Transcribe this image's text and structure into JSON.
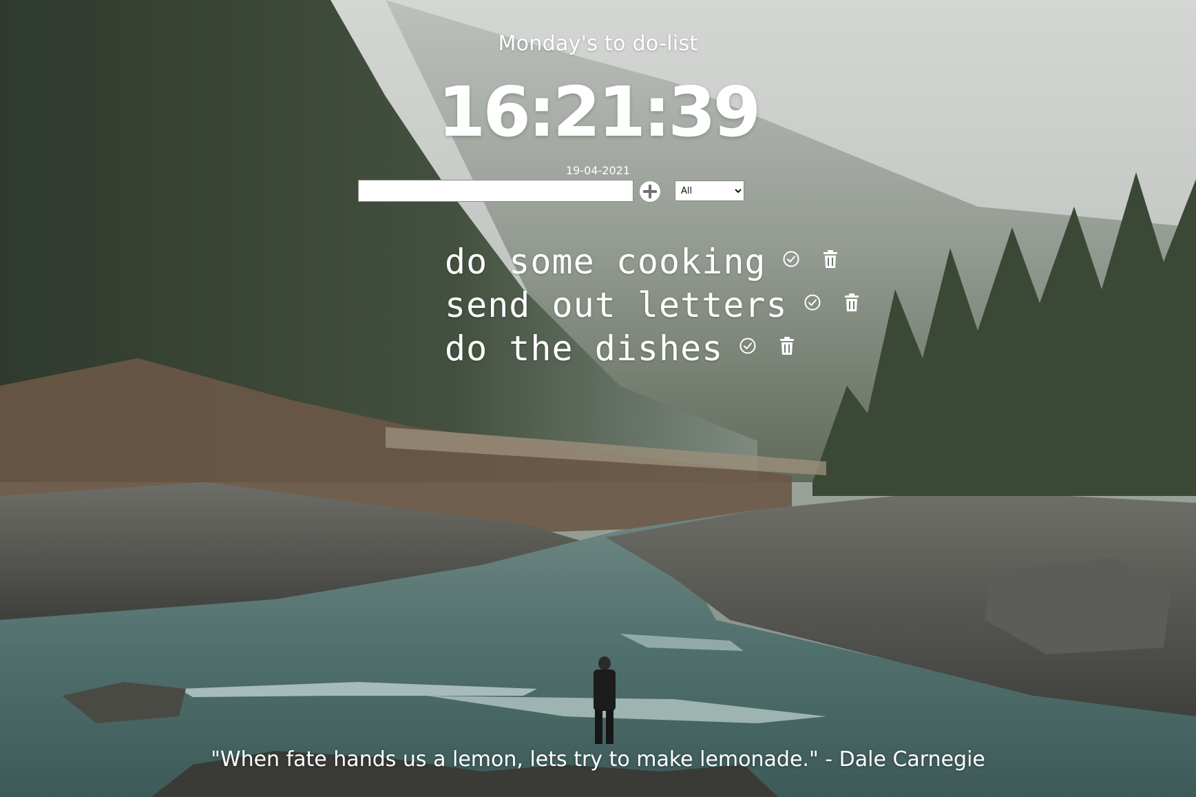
{
  "header": {
    "title": "Monday's to do-list",
    "clock": "16:21:39",
    "date": "19-04-2021"
  },
  "form": {
    "input_value": "",
    "input_placeholder": "",
    "add_icon": "plus-circle-icon",
    "filter_selected": "All"
  },
  "todos": [
    {
      "text": "do some cooking",
      "check_icon": "check-circle-icon",
      "delete_icon": "trash-icon"
    },
    {
      "text": "send out letters",
      "check_icon": "check-circle-icon",
      "delete_icon": "trash-icon"
    },
    {
      "text": "do the dishes",
      "check_icon": "check-circle-icon",
      "delete_icon": "trash-icon"
    }
  ],
  "footer": {
    "quote": "\"When fate hands us a lemon, lets try to make lemonade.\" - Dale Carnegie"
  },
  "colors": {
    "text": "#ffffff",
    "input_background": "#ffffff"
  }
}
